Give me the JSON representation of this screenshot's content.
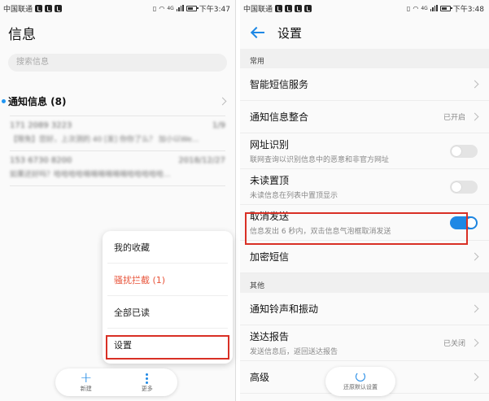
{
  "left": {
    "status": {
      "carrier": "中国联通",
      "time": "下午3:47",
      "signal_label": "4G"
    },
    "title": "信息",
    "search_placeholder": "搜索信息",
    "notice_label": "通知信息 (8)",
    "messages": [
      {
        "sender": "171 2089 3223",
        "date": "1/9",
        "body": "【限免】您好，上次测的 40 [发] 你你了么？ 加小以We..."
      },
      {
        "sender": "153 6730 8200",
        "date": "2018/12/27",
        "body": "如果还好吗？哈哈哈哈嘀嘀嘀嘀嘀嘀哈哈哈哈哈..."
      }
    ],
    "menu": [
      "我的收藏",
      "骚扰拦截 (1)",
      "全部已读",
      "设置"
    ],
    "bottom": {
      "new_label": "新建",
      "more_label": "更多"
    }
  },
  "right": {
    "status": {
      "carrier": "中国联通",
      "time": "下午3:48",
      "signal_label": "4G"
    },
    "title": "设置",
    "section_common": "常用",
    "section_other": "其他",
    "rows": {
      "smart": {
        "title": "智能短信服务"
      },
      "merge": {
        "title": "通知信息整合",
        "value": "已开启"
      },
      "url": {
        "title": "网址识别",
        "sub": "联网查询以识别信息中的恶意和非官方网址"
      },
      "unread": {
        "title": "未读置顶",
        "sub": "未读信息在列表中置顶显示"
      },
      "cancel": {
        "title": "取消发送",
        "sub": "信息发出 6 秒内，双击信息气泡框取消发送"
      },
      "encrypt": {
        "title": "加密短信"
      },
      "ringtone": {
        "title": "通知铃声和振动"
      },
      "report": {
        "title": "送达报告",
        "sub": "发送信息后，返回送达报告",
        "value": "已关闭"
      },
      "advanced": {
        "title": "高级"
      }
    },
    "restore_label": "还原默认设置"
  },
  "toggles": {
    "url": false,
    "unread": false,
    "cancel": true
  },
  "colors": {
    "accent": "#1e88e5",
    "highlight": "#d93025",
    "spam": "#e8543a"
  }
}
